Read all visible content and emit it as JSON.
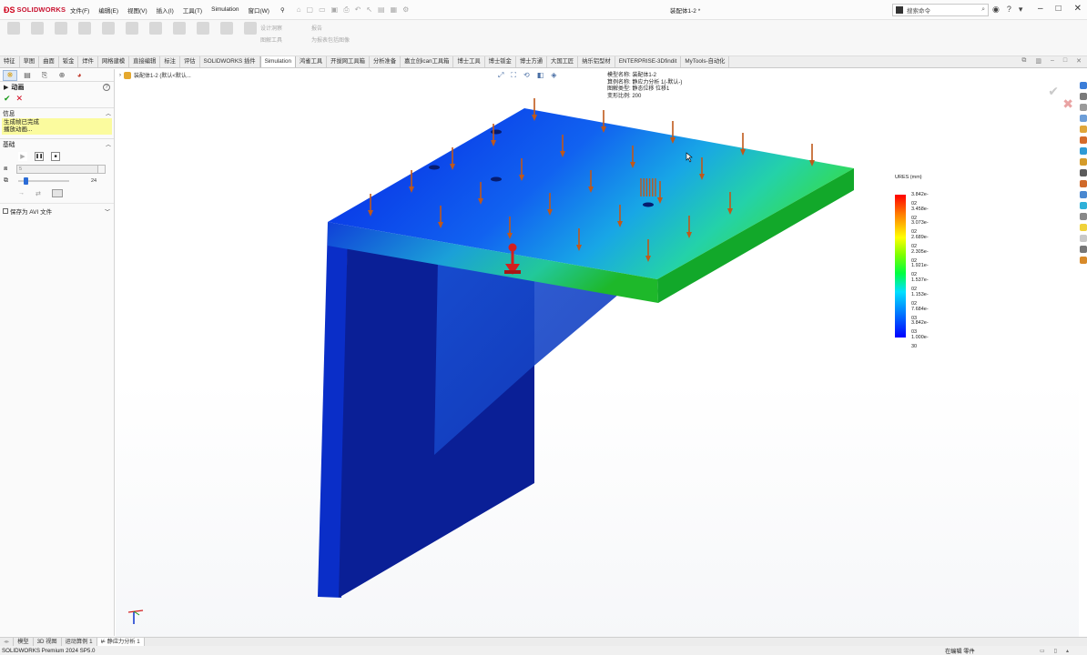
{
  "app": {
    "brand": "SOLIDWORKS",
    "document_title": "装配体1-2 *",
    "menus": [
      "文件(F)",
      "编辑(E)",
      "视图(V)",
      "插入(I)",
      "工具(T)",
      "Simulation",
      "窗口(W)"
    ],
    "search_placeholder": "搜索命令"
  },
  "command_manager": {
    "side_items": [
      "设计洞察",
      "图解工具",
      "报告",
      "为报表包括图像"
    ]
  },
  "tabs": [
    "特征",
    "草图",
    "曲面",
    "钣金",
    "焊件",
    "网格建模",
    "直接编辑",
    "标注",
    "评估",
    "SOLIDWORKS 插件",
    "Simulation",
    "鸿雀工具",
    "开拔网工具箱",
    "分析准备",
    "嘉立创ican工具箱",
    "博士工具",
    "博士钣金",
    "博士方通",
    "大国工匠",
    "纳乐铝型材",
    "ENTERPRISE-3Dfindit",
    "MyTools-自动化"
  ],
  "active_tab": "Simulation",
  "property_manager": {
    "title": "动画",
    "info_header": "信息",
    "info_lines": [
      "生成帧已完成",
      "播放动画..."
    ],
    "basic_header": "基础",
    "frames_value": "5",
    "speed_value": "24",
    "save_avi_label": "保存为 AVI 文件"
  },
  "viewport": {
    "breadcrumb": "装配体1-2 (默认<默认...",
    "plot_info": {
      "model_name": "模型名称: 装配体1-2",
      "study_name": "算例名称: 静应力分析 1(-默认-)",
      "plot_type": "图解类型: 静态位移 位移1",
      "deformation_scale": "变形比例: 200"
    },
    "legend": {
      "title": "URES (mm)",
      "labels": [
        "3.842e-02",
        "3.458e-02",
        "3.073e-02",
        "2.689e-02",
        "2.305e-02",
        "1.921e-02",
        "1.537e-02",
        "1.153e-02",
        "7.684e-03",
        "3.842e-03",
        "1.000e-30"
      ],
      "max_value": 0.03842,
      "min_value": 1e-30
    }
  },
  "bottom_tabs": [
    "模型",
    "3D 视图",
    "运动算例 1",
    "静应力分析 1"
  ],
  "status": {
    "product": "SOLIDWORKS Premium 2024 SP5.0",
    "mode": "在编辑 零件"
  },
  "colors": {
    "brand_red": "#c8102e",
    "info_yellow": "#fbfb9e",
    "load_arrow": "#c0581a",
    "fixture_red": "#d41f1f"
  }
}
